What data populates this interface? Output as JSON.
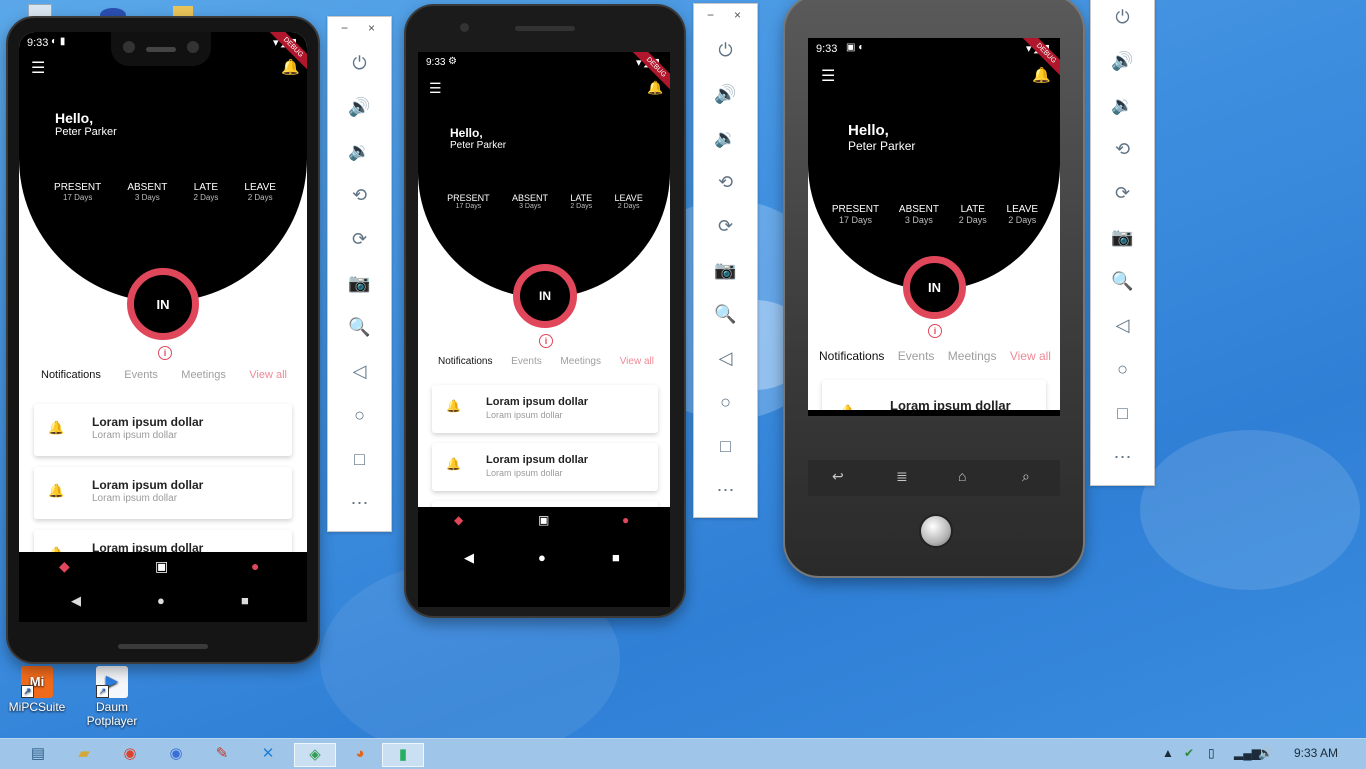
{
  "desktop": {
    "icons": [
      {
        "label": "MiPCSuite",
        "icon": "mipcsuite-app-icon"
      },
      {
        "label": "Daum Potplayer",
        "label_line1": "Daum",
        "label_line2": "Potplayer",
        "icon": "potplayer-app-icon"
      }
    ]
  },
  "phones": [
    {
      "status_time": "9:33",
      "debug_banner": "DEBUG",
      "greeting": "Hello,",
      "user_name": "Peter Parker",
      "stats": [
        {
          "label": "PRESENT",
          "value": "17 Days"
        },
        {
          "label": "ABSENT",
          "value": "3 Days"
        },
        {
          "label": "LATE",
          "value": "2 Days"
        },
        {
          "label": "LEAVE",
          "value": "2 Days"
        }
      ],
      "check_button": "IN",
      "tabs": [
        "Notifications",
        "Events",
        "Meetings"
      ],
      "view_all": "View all",
      "cards": [
        {
          "title": "Loram ipsum dollar",
          "subtitle": "Loram ipsum dollar"
        },
        {
          "title": "Loram ipsum dollar",
          "subtitle": "Loram ipsum dollar"
        },
        {
          "title": "Loram ipsum dollar",
          "subtitle": ""
        }
      ]
    },
    {
      "status_time": "9:33",
      "debug_banner": "DEBUG",
      "greeting": "Hello,",
      "user_name": "Peter Parker",
      "stats": [
        {
          "label": "PRESENT",
          "value": "17 Days"
        },
        {
          "label": "ABSENT",
          "value": "3 Days"
        },
        {
          "label": "LATE",
          "value": "2 Days"
        },
        {
          "label": "LEAVE",
          "value": "2 Days"
        }
      ],
      "check_button": "IN",
      "tabs": [
        "Notifications",
        "Events",
        "Meetings"
      ],
      "view_all": "View all",
      "cards": [
        {
          "title": "Loram ipsum dollar",
          "subtitle": "Loram ipsum dollar"
        },
        {
          "title": "Loram ipsum dollar",
          "subtitle": "Loram ipsum dollar"
        }
      ]
    },
    {
      "status_time": "9:33",
      "debug_banner": "DEBUG",
      "greeting": "Hello,",
      "user_name": "Peter Parker",
      "stats": [
        {
          "label": "PRESENT",
          "value": "17 Days"
        },
        {
          "label": "ABSENT",
          "value": "3 Days"
        },
        {
          "label": "LATE",
          "value": "2 Days"
        },
        {
          "label": "LEAVE",
          "value": "2 Days"
        }
      ],
      "check_button": "IN",
      "tabs": [
        "Notifications",
        "Events",
        "Meetings"
      ],
      "view_all": "View all",
      "cards": [
        {
          "title": "Loram ipsum dollar",
          "subtitle": ""
        }
      ]
    }
  ],
  "emulator_toolbar": {
    "minimize": "−",
    "close": "×",
    "buttons": [
      "power",
      "volume-up",
      "volume-down",
      "rotate-left",
      "rotate-right",
      "screenshot",
      "zoom",
      "back",
      "home",
      "overview",
      "more"
    ]
  },
  "taskbar": {
    "apps": [
      "file-explorer",
      "chrome",
      "chromium",
      "paint",
      "vscode",
      "android-studio",
      "firefox",
      "emulator"
    ],
    "clock": "9:33 AM"
  },
  "colors": {
    "accent": "#e0475b",
    "view_all": "#f08a96",
    "desktop_blue": "#3f8fe0"
  }
}
